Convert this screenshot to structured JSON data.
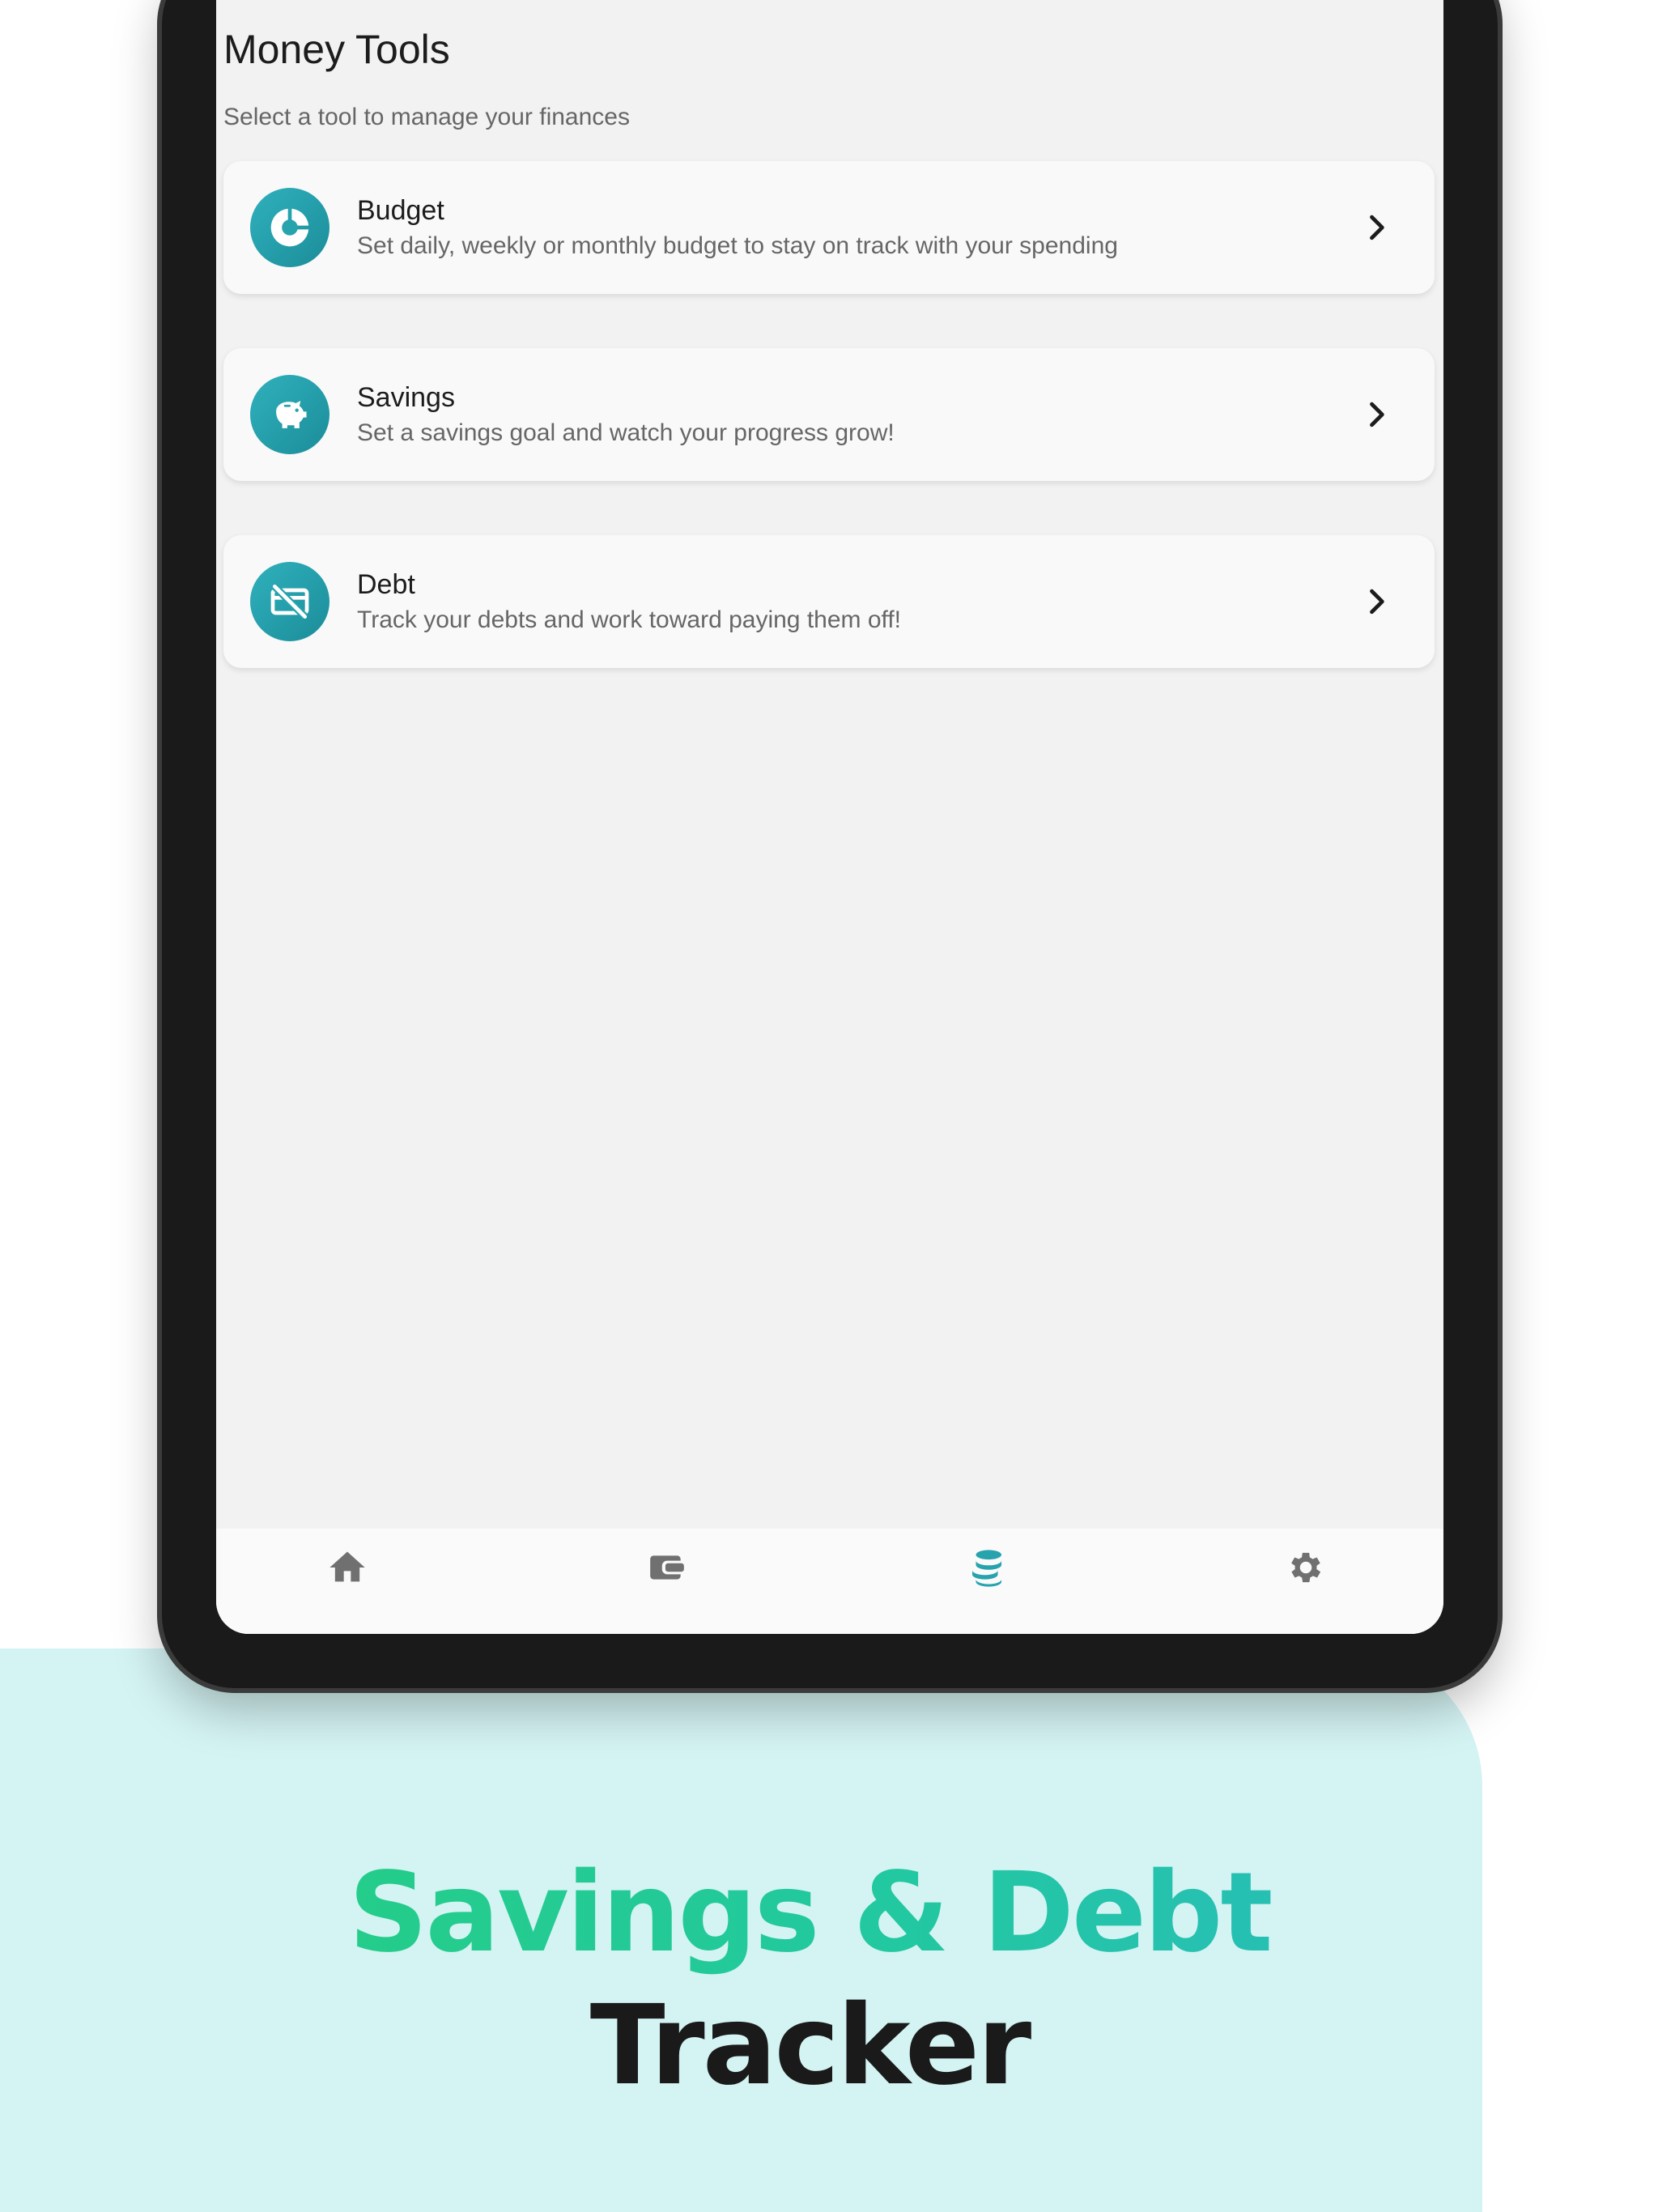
{
  "screen": {
    "title": "Money Tools",
    "subtitle": "Select a tool to manage your finances"
  },
  "tools": [
    {
      "title": "Budget",
      "description": "Set daily, weekly or monthly budget to stay on track with your spending",
      "icon": "pie-chart-icon"
    },
    {
      "title": "Savings",
      "description": "Set a savings goal and watch your progress grow!",
      "icon": "piggy-bank-icon"
    },
    {
      "title": "Debt",
      "description": "Track your debts and work toward paying them off!",
      "icon": "no-card-icon"
    }
  ],
  "bottom_nav": [
    {
      "icon": "home-icon",
      "active": false
    },
    {
      "icon": "wallet-icon",
      "active": false
    },
    {
      "icon": "coins-stack-icon",
      "active": true
    },
    {
      "icon": "gear-icon",
      "active": false
    }
  ],
  "promo": {
    "headline_line1": "Savings & Debt",
    "headline_line2": "Tracker"
  },
  "colors": {
    "accent": "#1f9aa6",
    "headline_gradient_start": "#26d07c",
    "headline_gradient_end": "#2bb8c5",
    "backdrop": "#d4f3f3",
    "nav_icon": "#707070"
  }
}
